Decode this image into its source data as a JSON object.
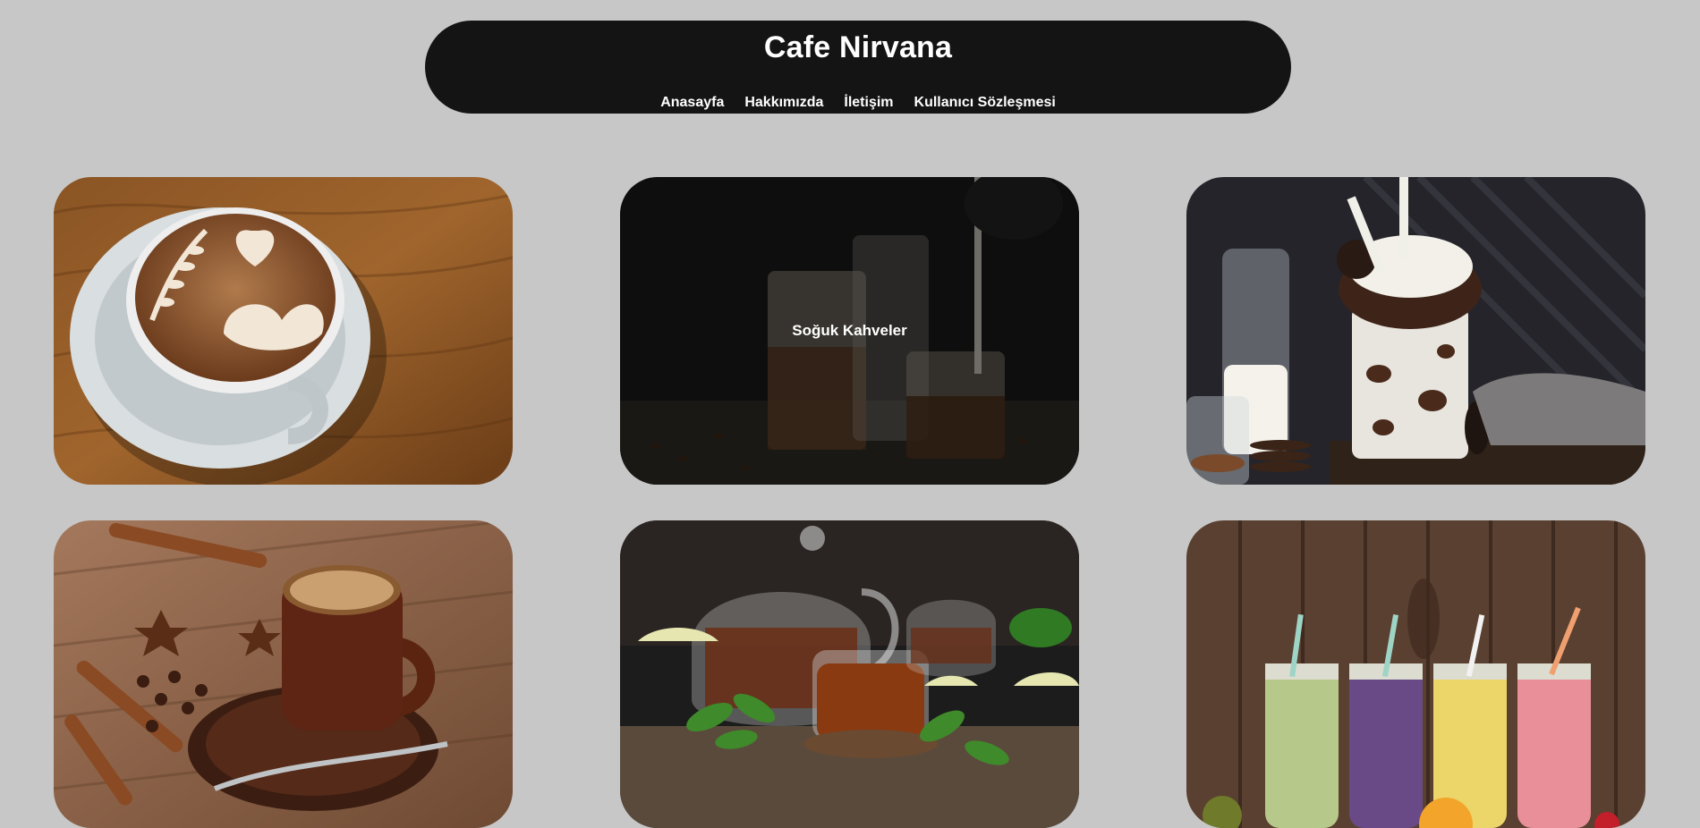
{
  "header": {
    "title": "Cafe Nirvana",
    "nav": [
      {
        "label": "Anasayfa"
      },
      {
        "label": "Hakkımızda"
      },
      {
        "label": "İletişim"
      },
      {
        "label": "Kullanıcı Sözleşmesi"
      }
    ]
  },
  "cards": [
    {
      "image": "latte-art-cup-image"
    },
    {
      "image": "iced-coffee-image",
      "overlay_label": "Soğuk Kahveler"
    },
    {
      "image": "cookies-milkshake-image"
    },
    {
      "image": "espresso-cup-image"
    },
    {
      "image": "tea-pot-image"
    },
    {
      "image": "smoothie-jars-image"
    }
  ],
  "colors": {
    "background": "#c7c7c7",
    "header_background": "#141414",
    "header_text": "#ffffff"
  }
}
